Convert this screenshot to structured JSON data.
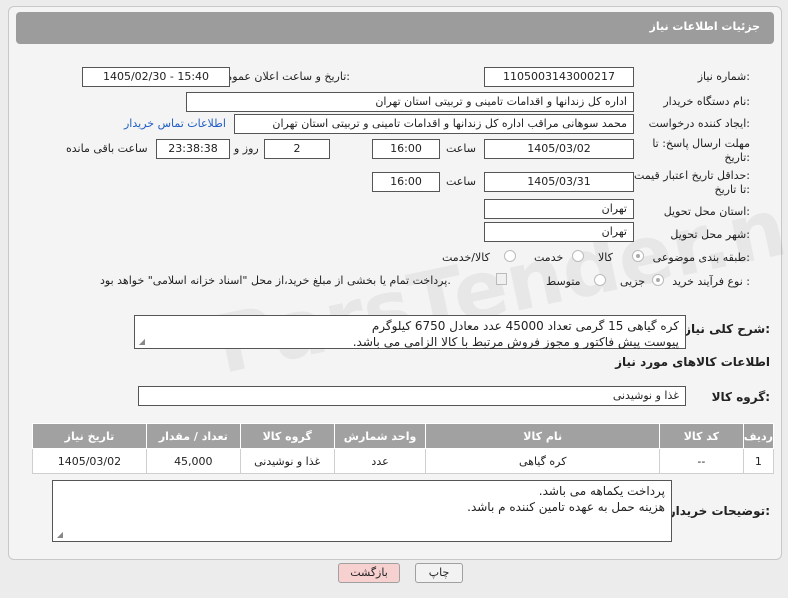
{
  "header": {
    "title": "جزئیات اطلاعات نیاز"
  },
  "fields": {
    "need_number_label": "شماره نیاز:",
    "need_number": "1105003143000217",
    "announce_label": "تاریخ و ساعت اعلان عمومی:",
    "announce_value": "1405/02/30 - 15:40",
    "buyer_org_label": "نام دستگاه خریدار:",
    "buyer_org": "اداره کل زندانها و اقدامات تامینی و تربیتی استان تهران",
    "creator_label": "ایجاد کننده درخواست:",
    "creator": "محمد سوهانی مراقب  اداره کل زندانها و اقدامات تامینی و تربیتی استان تهران",
    "buyer_contact_link": "اطلاعات تماس خریدار",
    "deadline_label_1": "مهلت ارسال پاسخ: تا",
    "deadline_label_2": "تاریخ:",
    "deadline_date": "1405/03/02",
    "time_label": "ساعت",
    "deadline_time": "16:00",
    "days_value": "2",
    "days_label": "روز و",
    "remaining_time": "23:38:38",
    "remaining_label": "ساعت باقی مانده",
    "price_validity_label_1": "حداقل تاریخ اعتبار قیمت:",
    "price_validity_label_2": "تا تاریخ:",
    "price_validity_date": "1405/03/31",
    "price_validity_time": "16:00",
    "delivery_province_label": "استان محل تحویل:",
    "delivery_province": "تهران",
    "delivery_city_label": "شهر محل تحویل:",
    "delivery_city": "تهران",
    "category_label": "طبقه بندی موضوعی:",
    "category_options": [
      "کالا",
      "خدمت",
      "کالا/خدمت"
    ],
    "process_label": "نوع فرآیند خرید :",
    "process_options": [
      "جزیی",
      "متوسط"
    ],
    "treasury_note": "پرداخت تمام یا بخشی از مبلغ خرید،از محل \"اسناد خزانه اسلامی\" خواهد بود.",
    "description_label": "شرح کلی نیاز:",
    "description_lines": [
      "کره گیاهی 15 گرمی تعداد 45000 عدد معادل 6750 کیلوگرم",
      "پیوست پیش فاکتور و مجوز فروش مرتبط با کالا الزامی می باشد."
    ],
    "goods_info_title": "اطلاعات کالاهای مورد نیاز",
    "goods_group_label": "گروه کالا:",
    "goods_group": "غذا و نوشیدنی",
    "buyer_notes_label": "توضیحات خریدار:",
    "buyer_notes_lines": [
      "پرداخت یکماهه می باشد.",
      "هزینه حمل به عهده تامین کننده م باشد."
    ]
  },
  "table": {
    "headers": [
      "ردیف",
      "کد کالا",
      "نام کالا",
      "واحد شمارش",
      "گروه کالا",
      "تعداد / مقدار",
      "تاریخ نیاز"
    ],
    "rows": [
      [
        "1",
        "--",
        "کره گیاهی",
        "عدد",
        "غذا و نوشیدنی",
        "45,000",
        "1405/03/02"
      ]
    ]
  },
  "buttons": {
    "print": "چاپ",
    "back": "بازگشت"
  },
  "watermark": "ParsTender.net",
  "colors": {
    "header_bg": "#9c9c9c",
    "link": "#1f5ec5",
    "back_button_bg": "#f7d0d0"
  }
}
